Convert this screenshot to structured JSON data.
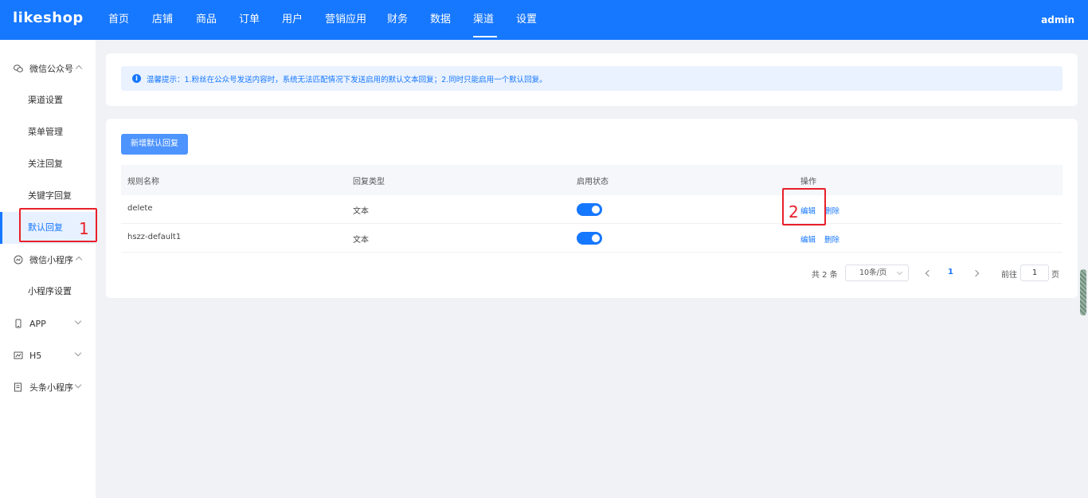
{
  "header": {
    "logo": "likeshop",
    "nav": [
      "首页",
      "店铺",
      "商品",
      "订单",
      "用户",
      "营销应用",
      "财务",
      "数据",
      "渠道",
      "设置"
    ],
    "active_nav": "渠道",
    "user": "admin"
  },
  "sidebar": {
    "groups": [
      {
        "label": "微信公众号",
        "icon": "wechat-icon",
        "expanded": true,
        "items": [
          "渠道设置",
          "菜单管理",
          "关注回复",
          "关键字回复",
          "默认回复"
        ]
      },
      {
        "label": "微信小程序",
        "icon": "miniprogram-icon",
        "expanded": true,
        "items": [
          "小程序设置"
        ]
      },
      {
        "label": "APP",
        "icon": "phone-icon",
        "expanded": false,
        "items": []
      },
      {
        "label": "H5",
        "icon": "h5-icon",
        "expanded": false,
        "items": []
      },
      {
        "label": "头条小程序",
        "icon": "toutiao-icon",
        "expanded": false,
        "items": []
      }
    ],
    "active_item": "默认回复"
  },
  "tip": {
    "icon": "info-icon",
    "text": "温馨提示：1.粉丝在公众号发送内容时，系统无法匹配情况下发送启用的默认文本回复；2.同时只能启用一个默认回复。"
  },
  "toolbar": {
    "add_button": "新增默认回复"
  },
  "table": {
    "columns": [
      "规则名称",
      "回复类型",
      "启用状态",
      "操作"
    ],
    "rows": [
      {
        "name": "delete",
        "type": "文本",
        "enabled": true,
        "edit": "编辑",
        "delete": "删除"
      },
      {
        "name": "hszz-default1",
        "type": "文本",
        "enabled": true,
        "edit": "编辑",
        "delete": "删除"
      }
    ]
  },
  "pagination": {
    "total": "共 2 条",
    "page_size": "10条/页",
    "current_page": "1",
    "goto_label": "前往",
    "goto_value": "1",
    "page_suffix": "页"
  },
  "annotations": {
    "label1": "1",
    "label2": "2",
    "color": "#e8202a"
  },
  "colors": {
    "primary": "#1677ff",
    "tip_bg": "#eaf2ff"
  }
}
